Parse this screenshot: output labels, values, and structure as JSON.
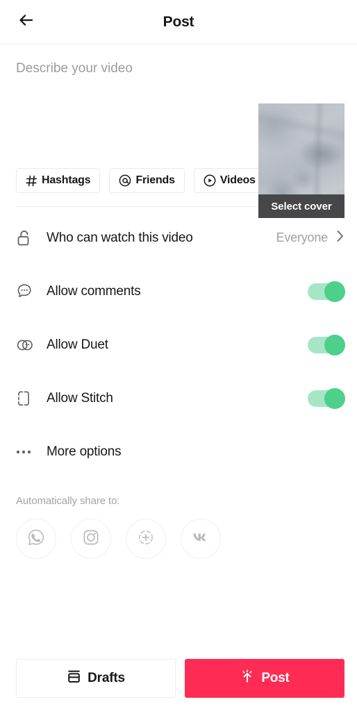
{
  "header": {
    "title": "Post",
    "back_icon": "arrow-left-icon"
  },
  "compose": {
    "description_value": "",
    "description_placeholder": "Describe your video",
    "cover": {
      "label": "Select cover",
      "thumbnail_alt": "snowy landscape video frame"
    }
  },
  "chips": [
    {
      "id": "hashtags",
      "label": "Hashtags",
      "icon": "hash-icon"
    },
    {
      "id": "friends",
      "label": "Friends",
      "icon": "at-icon"
    },
    {
      "id": "videos",
      "label": "Videos",
      "icon": "play-circle-icon"
    }
  ],
  "settings": [
    {
      "id": "privacy",
      "label": "Who can watch this video",
      "icon": "unlock-icon",
      "type": "select",
      "value": "Everyone",
      "chevron": "chevron-right-icon"
    },
    {
      "id": "allow-comments",
      "label": "Allow comments",
      "icon": "comment-bubble-icon",
      "type": "toggle",
      "value": "on"
    },
    {
      "id": "allow-duet",
      "label": "Allow Duet",
      "icon": "duet-icon",
      "type": "toggle",
      "value": "on"
    },
    {
      "id": "allow-stitch",
      "label": "Allow Stitch",
      "icon": "stitch-icon",
      "type": "toggle",
      "value": "on"
    },
    {
      "id": "more-options",
      "label": "More options",
      "icon": "ellipsis-icon",
      "type": "link",
      "value": ""
    }
  ],
  "share": {
    "title": "Automatically share to:",
    "targets": [
      {
        "id": "whatsapp",
        "icon": "whatsapp-icon"
      },
      {
        "id": "instagram",
        "icon": "instagram-icon"
      },
      {
        "id": "instagram-story",
        "icon": "instagram-story-icon"
      },
      {
        "id": "vk",
        "icon": "vk-icon"
      }
    ]
  },
  "footer": {
    "drafts_label": "Drafts",
    "drafts_icon": "inbox-icon",
    "post_label": "Post",
    "post_icon": "upload-sparkle-icon"
  },
  "colors": {
    "accent_post": "#fe2c55",
    "toggle_track": "#a7e6c5",
    "toggle_knob": "#4cd08a",
    "text_primary": "#17161a",
    "text_muted": "#a0a0a6",
    "cover_overlay": "#474749"
  }
}
